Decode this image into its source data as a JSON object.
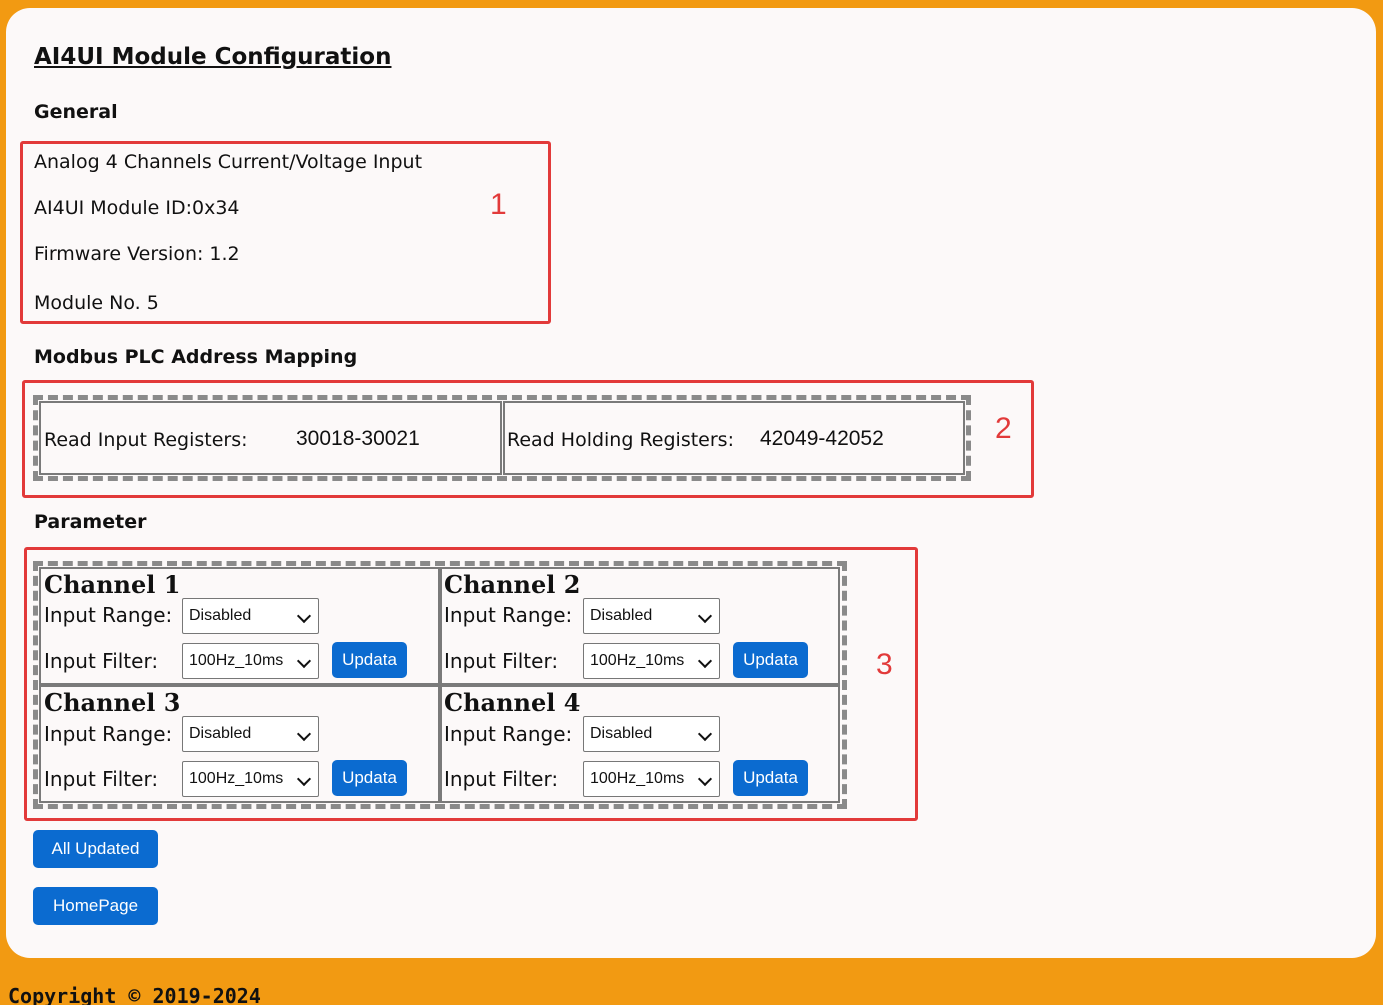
{
  "title": "AI4UI Module Configuration",
  "general": {
    "heading": "General",
    "lines": [
      "Analog 4 Channels Current/Voltage Input",
      "AI4UI Module ID:0x34",
      "Firmware Version: 1.2",
      "Module No. 5"
    ]
  },
  "modbus": {
    "heading": "Modbus PLC Address Mapping",
    "read_input_label": "Read Input Registers:",
    "read_input_value": "30018-30021",
    "read_holding_label": "Read Holding Registers:",
    "read_holding_value": "42049-42052"
  },
  "parameter": {
    "heading": "Parameter",
    "input_range_label": "Input Range:",
    "input_filter_label": "Input Filter:",
    "update_label": "Updata",
    "channels": [
      {
        "name": "Channel 1",
        "input_range": "Disabled",
        "input_filter": "100Hz_10ms"
      },
      {
        "name": "Channel 2",
        "input_range": "Disabled",
        "input_filter": "100Hz_10ms"
      },
      {
        "name": "Channel 3",
        "input_range": "Disabled",
        "input_filter": "100Hz_10ms"
      },
      {
        "name": "Channel 4",
        "input_range": "Disabled",
        "input_filter": "100Hz_10ms"
      }
    ]
  },
  "buttons": {
    "all_updated": "All Updated",
    "homepage": "HomePage"
  },
  "annotations": [
    "1",
    "2",
    "3"
  ],
  "colors": {
    "page_border": "#f29a12",
    "panel": "#fcf9f9",
    "annotation_red": "#e23a3a",
    "button_blue": "#0b6bd0"
  },
  "footer": "Copyright © 2019-2024"
}
